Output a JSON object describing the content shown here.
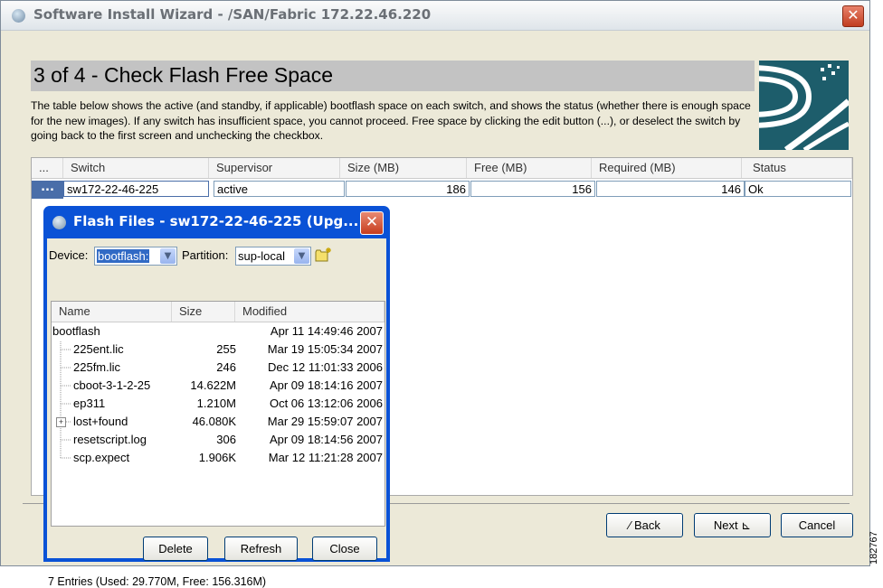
{
  "window": {
    "title": "Software Install Wizard - /SAN/Fabric 172.22.46.220",
    "close_glyph": "✕"
  },
  "step": {
    "heading": "3 of 4 - Check Flash Free Space",
    "description": "The table below shows the active (and standby, if applicable) bootflash space on each switch, and shows the status (whether there is enough space for the new images). If any switch has insufficient space, you cannot proceed. Free space by clicking the edit button (...), or deselect the switch by going back to the first screen and unchecking the checkbox."
  },
  "switch_table": {
    "columns": [
      "...",
      "Switch",
      "Supervisor",
      "Size (MB)",
      "Free (MB)",
      "Required (MB)",
      "Status"
    ],
    "rows": [
      {
        "edit": "...",
        "switch": "sw172-22-46-225",
        "supervisor": "active",
        "size": "186",
        "free": "156",
        "required": "146",
        "status": "Ok"
      }
    ]
  },
  "nav_buttons": {
    "back": "Back",
    "next": "Next",
    "cancel": "Cancel"
  },
  "dialog": {
    "title": "Flash Files - sw172-22-46-225 (Upg...",
    "close_glyph": "✕",
    "device_label": "Device:",
    "device_value": "bootflash:",
    "partition_label": "Partition:",
    "partition_value": "sup-local",
    "columns": [
      "Name",
      "Size",
      "Modified"
    ],
    "files": [
      {
        "name": "bootflash",
        "size": "",
        "modified": "Apr 11 14:49:46 2007"
      },
      {
        "name": "225ent.lic",
        "size": "255",
        "modified": "Mar 19 15:05:34 2007"
      },
      {
        "name": "225fm.lic",
        "size": "246",
        "modified": "Dec 12 11:01:33 2006"
      },
      {
        "name": "cboot-3-1-2-25",
        "size": "14.622M",
        "modified": "Apr 09 18:14:16 2007"
      },
      {
        "name": "ep311",
        "size": "1.210M",
        "modified": "Oct 06 13:12:06 2006"
      },
      {
        "name": "lost+found",
        "size": "46.080K",
        "modified": "Mar 29 15:59:07 2007"
      },
      {
        "name": "resetscript.log",
        "size": "306",
        "modified": "Apr 09 18:14:56 2007"
      },
      {
        "name": "scp.expect",
        "size": "1.906K",
        "modified": "Mar 12 11:21:28 2007"
      }
    ],
    "buttons": {
      "delete": "Delete",
      "refresh": "Refresh",
      "close": "Close"
    },
    "status": "7 Entries (Used: 29.770M, Free: 156.316M)"
  },
  "figure_id": "182767",
  "colors": {
    "dialog_border": "#0a52d6",
    "heading_bar": "#c3c3c3",
    "selected_row": "#4a6ea9",
    "logo": "#1d5d6b"
  },
  "icons": [
    "app-icon",
    "close-icon",
    "cisco-logo",
    "new-folder-icon",
    "expand-plus-icon",
    "back-arrow-icon",
    "next-arrow-icon"
  ]
}
